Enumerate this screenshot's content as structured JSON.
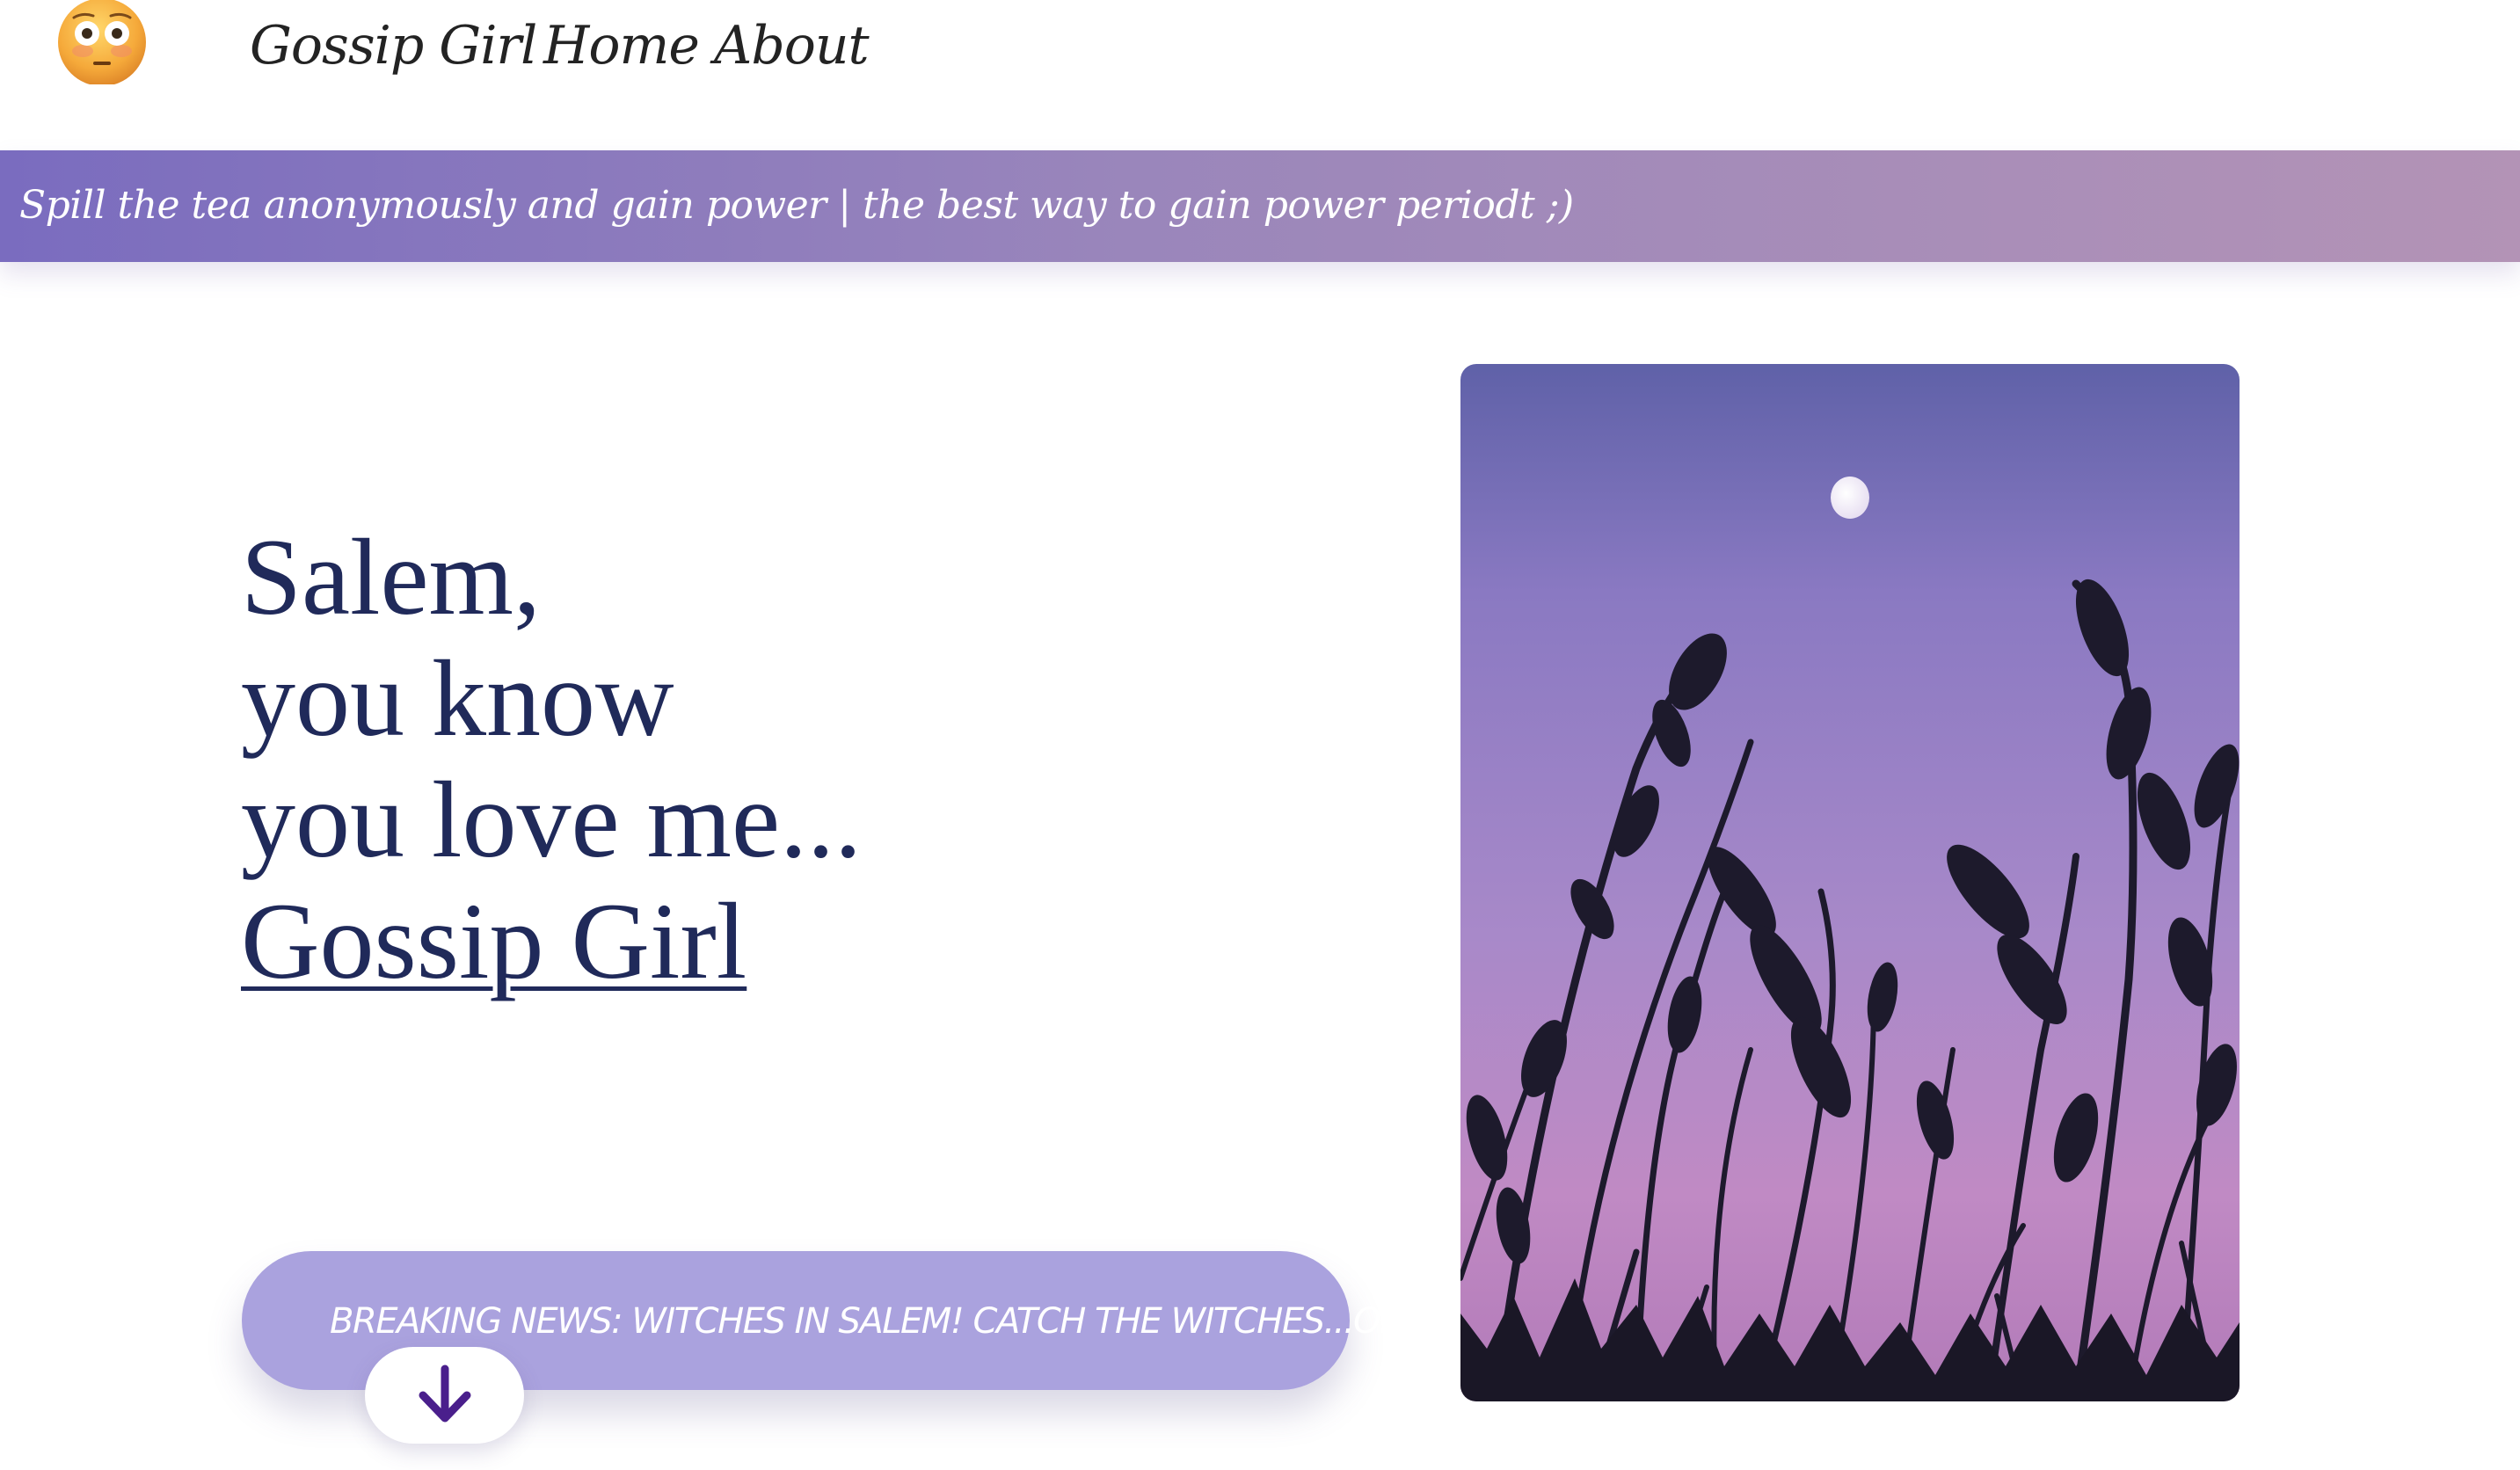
{
  "nav": {
    "logo_icon": "flushed-face-emoji-icon",
    "brand": "Gossip Girl",
    "home": "Home",
    "about": "About"
  },
  "banner": {
    "text": "Spill the tea anonymously and gain power | the best way to gain power periodt ;)"
  },
  "hero": {
    "line1": "Salem,",
    "line2": "you know",
    "line3": "you love me...",
    "link": "Gossip Girl"
  },
  "news": {
    "text": "BREAKING NEWS: WITCHES IN SALEM! CATCH THE WITCHES...OR ELSE",
    "scroll_icon": "arrow-down-icon"
  },
  "image": {
    "subject": "moon-and-grass-silhouette-photo"
  },
  "colors": {
    "heading": "#202a5a",
    "banner_start": "#7a6cbf",
    "banner_end": "#b393b6",
    "pill": "#aaa2de",
    "arrow": "#4a1f8c"
  }
}
